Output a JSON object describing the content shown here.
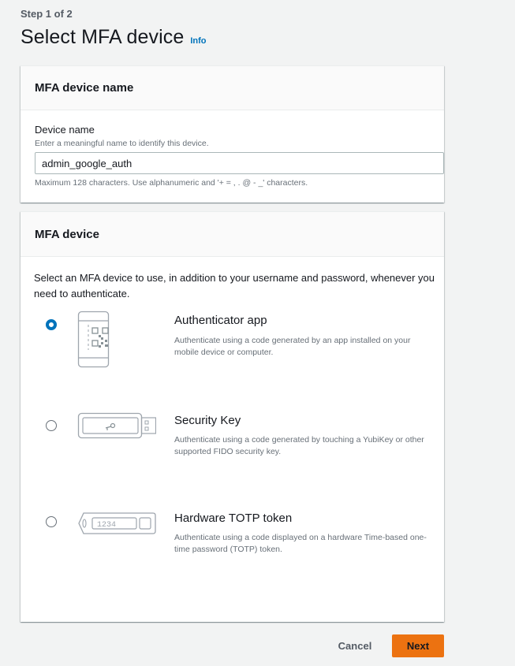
{
  "header": {
    "step": "Step 1 of 2",
    "title": "Select MFA device",
    "info_link": "Info"
  },
  "device_name_panel": {
    "heading": "MFA device name",
    "label": "Device name",
    "description": "Enter a meaningful name to identify this device.",
    "value": "admin_google_auth",
    "constraint": "Maximum 128 characters. Use alphanumeric and '+ = , . @ - _' characters."
  },
  "device_panel": {
    "heading": "MFA device",
    "intro": "Select an MFA device to use, in addition to your username and password, whenever you need to authenticate.",
    "options": [
      {
        "title": "Authenticator app",
        "description": "Authenticate using a code generated by an app installed on your mobile device or computer.",
        "selected": true,
        "icon": "phone-qr-icon"
      },
      {
        "title": "Security Key",
        "description": "Authenticate using a code generated by touching a YubiKey or other supported FIDO security key.",
        "selected": false,
        "icon": "usb-key-icon"
      },
      {
        "title": "Hardware TOTP token",
        "description": "Authenticate using a code displayed on a hardware Time-based one-time password (TOTP) token.",
        "selected": false,
        "icon": "totp-token-icon",
        "token_display": "1234"
      }
    ]
  },
  "footer": {
    "cancel_label": "Cancel",
    "next_label": "Next"
  },
  "colors": {
    "accent": "#0073bb",
    "primary_button": "#ec7211",
    "background": "#f2f3f3"
  }
}
